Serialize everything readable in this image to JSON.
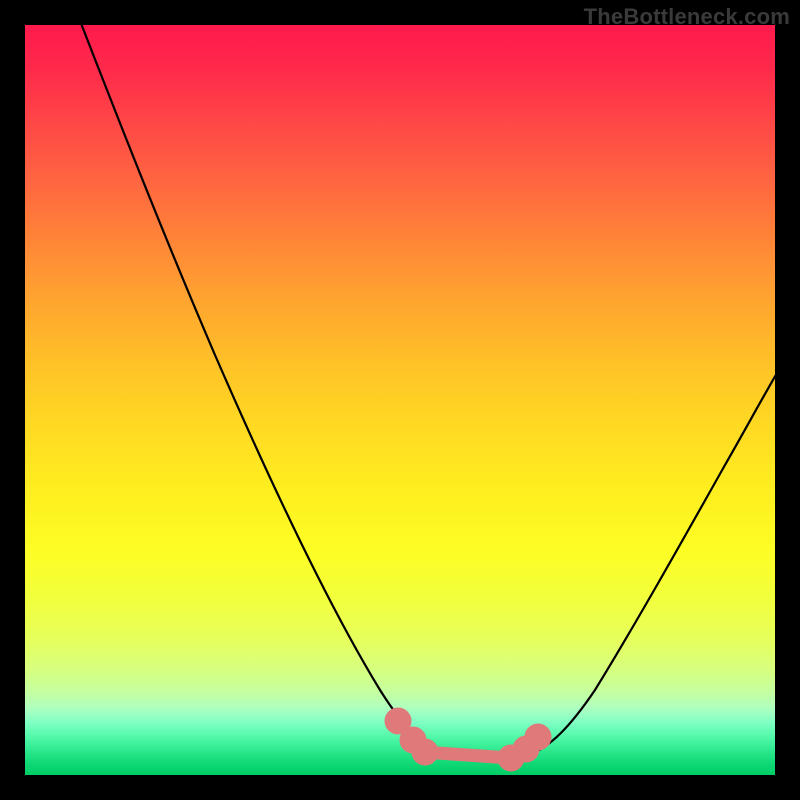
{
  "watermark": "TheBottleneck.com",
  "chart_data": {
    "type": "line",
    "title": "",
    "xlabel": "",
    "ylabel": "",
    "xlim": [
      0,
      100
    ],
    "ylim": [
      0,
      100
    ],
    "x": [
      0,
      4,
      8,
      12,
      16,
      20,
      24,
      28,
      32,
      36,
      40,
      44,
      48,
      50,
      52,
      54,
      56,
      58,
      60,
      62,
      64,
      66,
      68,
      72,
      76,
      80,
      84,
      88,
      92,
      96,
      100
    ],
    "values": [
      110,
      100,
      91,
      82,
      73,
      64,
      55.5,
      47,
      39,
      31,
      24,
      17.5,
      11.5,
      9,
      7,
      5.4,
      4.1,
      3.2,
      2.6,
      2.3,
      2.15,
      2.2,
      2.7,
      4.7,
      8.2,
      13,
      19,
      26,
      34,
      43,
      52
    ],
    "marker_band": {
      "x_range": [
        50,
        68
      ],
      "y_range": [
        2.0,
        4.5
      ],
      "color": "#e07a7a"
    },
    "colors": {
      "line": "#000000",
      "marker": "#e07a7a",
      "background_gradient": [
        "#ff1a4d",
        "#ffee20",
        "#00cc66"
      ]
    }
  }
}
